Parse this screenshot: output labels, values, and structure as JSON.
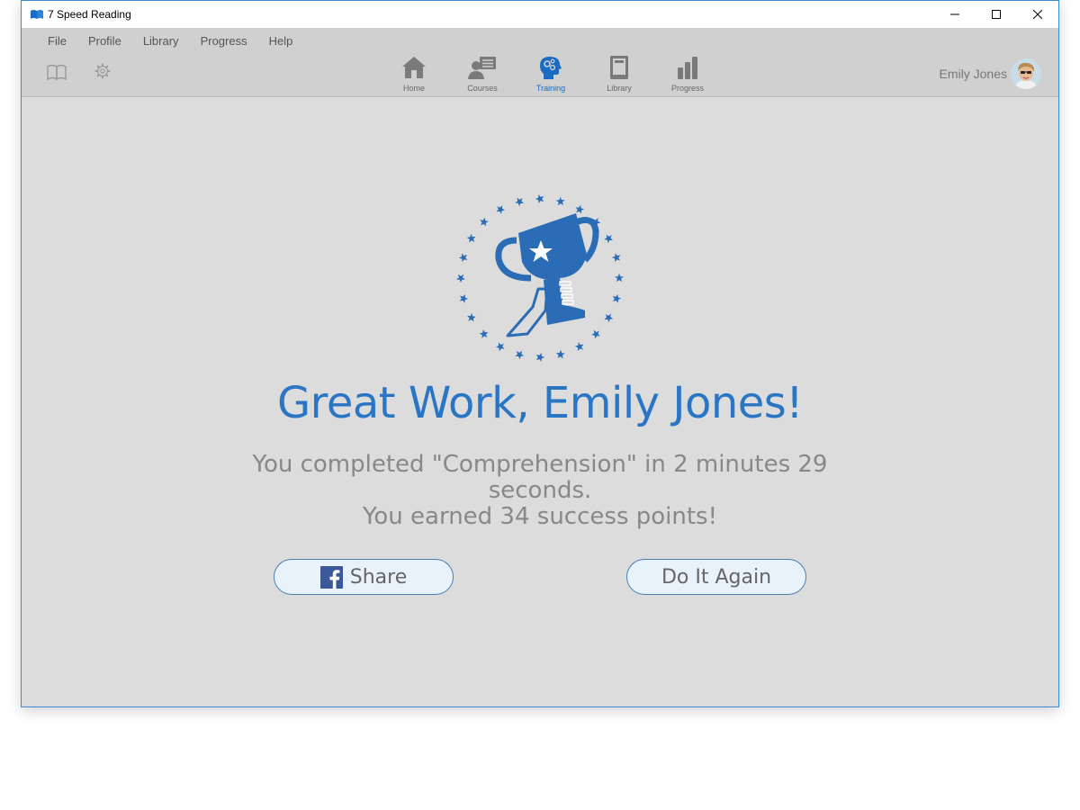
{
  "window": {
    "title": "7 Speed Reading"
  },
  "menu": [
    "File",
    "Profile",
    "Library",
    "Progress",
    "Help"
  ],
  "nav": [
    {
      "label": "Home",
      "icon": "home-icon",
      "active": false
    },
    {
      "label": "Courses",
      "icon": "courses-icon",
      "active": false
    },
    {
      "label": "Training",
      "icon": "training-icon",
      "active": true
    },
    {
      "label": "Library",
      "icon": "library-icon",
      "active": false
    },
    {
      "label": "Progress",
      "icon": "progress-icon",
      "active": false
    }
  ],
  "user": {
    "name": "Emily Jones"
  },
  "result": {
    "headline": "Great Work, Emily Jones!",
    "line1": "You completed \"Comprehension\" in 2 minutes 29 seconds.",
    "line2": "You earned 34 success points!"
  },
  "buttons": {
    "share": "Share",
    "again": "Do It Again"
  },
  "colors": {
    "accent": "#2a75c4",
    "nav_icon": "#777777",
    "background": "#dcdcdc"
  }
}
